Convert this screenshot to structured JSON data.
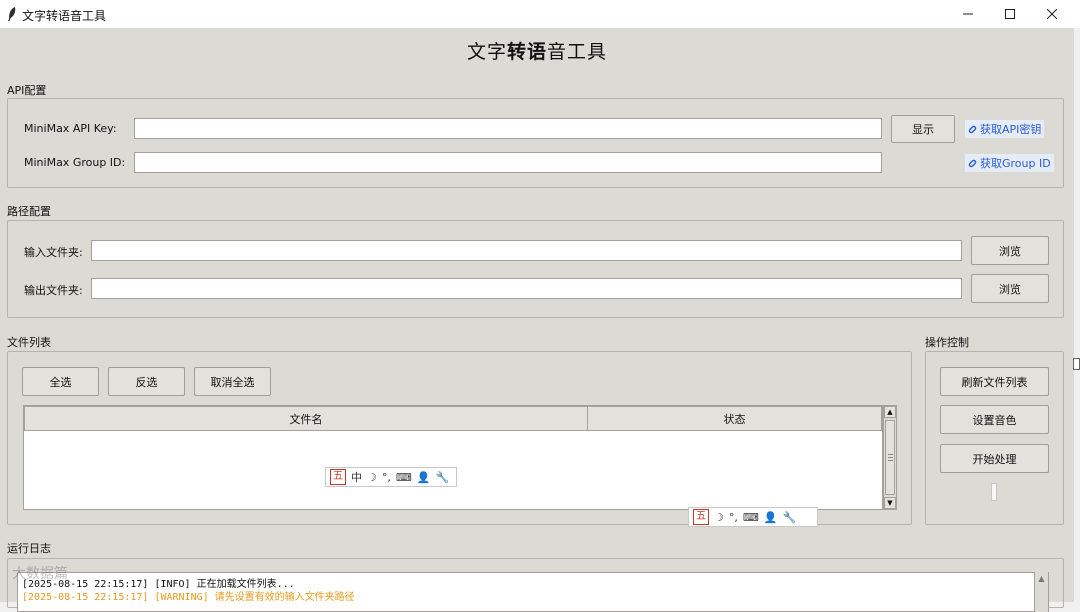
{
  "window": {
    "title": "文字转语音工具",
    "minimize_symbol": "—",
    "maximize_symbol": "☐",
    "close_symbol": "✕"
  },
  "heading": {
    "pre": "文字",
    "bold": "转语",
    "post": "音工具"
  },
  "api_config": {
    "label": "API配置",
    "api_key_label": "MiniMax API Key:",
    "api_key_value": "",
    "group_id_label": "MiniMax Group ID:",
    "group_id_value": "",
    "show_button": "显示",
    "get_api_key_link": "获取API密钥",
    "get_group_id_link": "获取Group ID"
  },
  "path_config": {
    "label": "路径配置",
    "input_folder_label": "输入文件夹:",
    "input_folder_value": "",
    "output_folder_label": "输出文件夹:",
    "output_folder_value": "",
    "browse_input": "浏览",
    "browse_output": "浏览"
  },
  "file_list": {
    "label": "文件列表",
    "select_all": "全选",
    "invert": "反选",
    "deselect_all": "取消全选",
    "columns": [
      "文件名",
      "状态"
    ],
    "rows": []
  },
  "controls": {
    "label": "操作控制",
    "refresh": "刷新文件列表",
    "set_voice": "设置音色",
    "start": "开始处理",
    "progress": 0
  },
  "ime_toolbar": {
    "cn_badge": "五",
    "mode": "中",
    "moon": "☽",
    "punct": "°,",
    "keyboard": "⌨",
    "user": "👤",
    "wrench": "🔧"
  },
  "log": {
    "label": "运行日志",
    "lines": [
      {
        "text": "[2025-08-15 22:15:17] [INFO] 正在加载文件列表...",
        "level": "info",
        "color": "#111111"
      },
      {
        "text": "[2025-08-15 22:15:17] [WARNING] 请先设置有效的输入文件夹路径",
        "level": "warning",
        "color": "#e69a1c"
      }
    ]
  },
  "watermark": "大数据篇"
}
